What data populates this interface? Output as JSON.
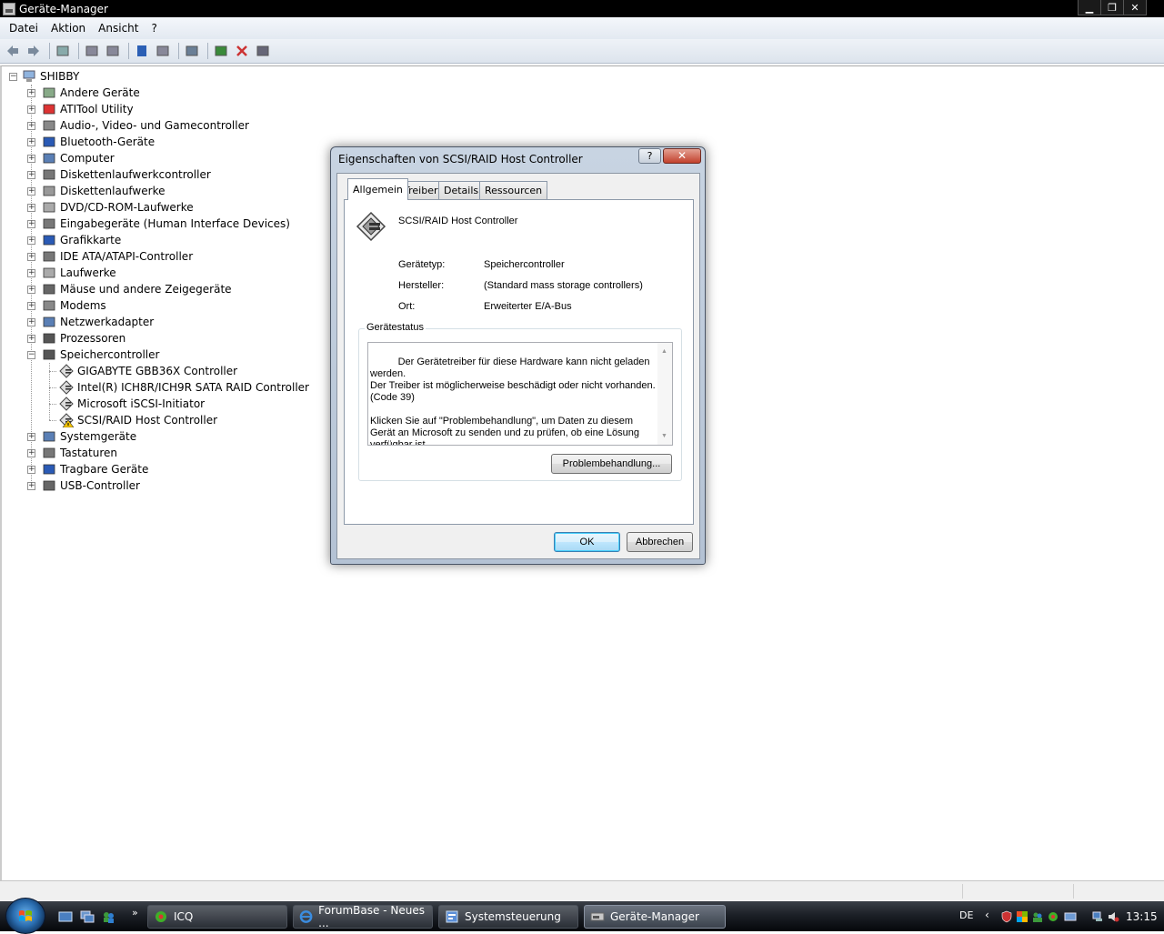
{
  "window": {
    "title": "Geräte-Manager",
    "min": "▁",
    "max": "❐",
    "close": "✕"
  },
  "menu": [
    "Datei",
    "Aktion",
    "Ansicht",
    "?"
  ],
  "toolbar": {
    "icons": [
      "back-icon",
      "forward-icon",
      "sep",
      "up-icon",
      "sep",
      "properties-icon",
      "show-hide-icon",
      "sep",
      "help-icon",
      "view-icon",
      "sep",
      "scan-hardware-icon",
      "sep",
      "update-driver-icon",
      "uninstall-icon",
      "disable-icon"
    ]
  },
  "tree": {
    "root": "SHIBBY",
    "categories": [
      {
        "label": "Andere Geräte",
        "icon": "other-devices-icon"
      },
      {
        "label": "ATITool Utility",
        "icon": "ati-icon"
      },
      {
        "label": "Audio-, Video- und Gamecontroller",
        "icon": "speaker-icon"
      },
      {
        "label": "Bluetooth-Geräte",
        "icon": "bluetooth-icon"
      },
      {
        "label": "Computer",
        "icon": "computer-icon"
      },
      {
        "label": "Diskettenlaufwerkcontroller",
        "icon": "floppy-controller-icon"
      },
      {
        "label": "Diskettenlaufwerke",
        "icon": "floppy-icon"
      },
      {
        "label": "DVD/CD-ROM-Laufwerke",
        "icon": "dvd-icon"
      },
      {
        "label": "Eingabegeräte (Human Interface Devices)",
        "icon": "hid-icon"
      },
      {
        "label": "Grafikkarte",
        "icon": "display-adapter-icon"
      },
      {
        "label": "IDE ATA/ATAPI-Controller",
        "icon": "ide-icon"
      },
      {
        "label": "Laufwerke",
        "icon": "disk-icon"
      },
      {
        "label": "Mäuse und andere Zeigegeräte",
        "icon": "mouse-icon"
      },
      {
        "label": "Modems",
        "icon": "modem-icon"
      },
      {
        "label": "Netzwerkadapter",
        "icon": "network-icon"
      },
      {
        "label": "Prozessoren",
        "icon": "cpu-icon"
      },
      {
        "label": "Speichercontroller",
        "icon": "storage-controller-icon"
      },
      {
        "label": "Systemgeräte",
        "icon": "system-icon"
      },
      {
        "label": "Tastaturen",
        "icon": "keyboard-icon"
      },
      {
        "label": "Tragbare Geräte",
        "icon": "portable-icon"
      },
      {
        "label": "USB-Controller",
        "icon": "usb-icon"
      }
    ],
    "storage_children": [
      {
        "label": "GIGABYTE GBB36X Controller",
        "warning": false
      },
      {
        "label": "Intel(R) ICH8R/ICH9R SATA RAID Controller",
        "warning": false
      },
      {
        "label": "Microsoft iSCSI-Initiator",
        "warning": false
      },
      {
        "label": "SCSI/RAID Host Controller",
        "warning": true
      }
    ],
    "expand_plus": "+",
    "expand_minus": "−"
  },
  "dialog": {
    "title": "Eigenschaften von SCSI/RAID Host Controller",
    "help": "?",
    "close": "✕",
    "tabs": [
      "Allgemein",
      "Treiber",
      "Details",
      "Ressourcen"
    ],
    "device_name": "SCSI/RAID Host Controller",
    "props": [
      {
        "label": "Gerätetyp:",
        "value": "Speichercontroller"
      },
      {
        "label": "Hersteller:",
        "value": "(Standard mass storage controllers)"
      },
      {
        "label": "Ort:",
        "value": "Erweiterter E/A-Bus"
      }
    ],
    "status_legend": "Gerätestatus",
    "status_text": "Der Gerätetreiber für diese Hardware kann nicht geladen werden.\nDer Treiber ist möglicherweise beschädigt oder nicht vorhanden.\n(Code 39)\n\nKlicken Sie auf \"Problembehandlung\", um Daten zu diesem Gerät an Microsoft zu senden und zu prüfen, ob eine Lösung verfügbar ist.",
    "troubleshoot": "Problembehandlung...",
    "ok": "OK",
    "cancel": "Abbrechen"
  },
  "taskbar": {
    "more": "»",
    "tasks": [
      {
        "label": "ICQ",
        "icon": "icq-icon",
        "active": false
      },
      {
        "label": "ForumBase - Neues ...",
        "icon": "ie-icon",
        "active": false
      },
      {
        "label": "Systemsteuerung",
        "icon": "control-panel-icon",
        "active": false
      },
      {
        "label": "Geräte-Manager",
        "icon": "device-manager-icon",
        "active": true
      }
    ],
    "lang": "DE",
    "tray_arrow": "‹",
    "clock": "13:15"
  }
}
